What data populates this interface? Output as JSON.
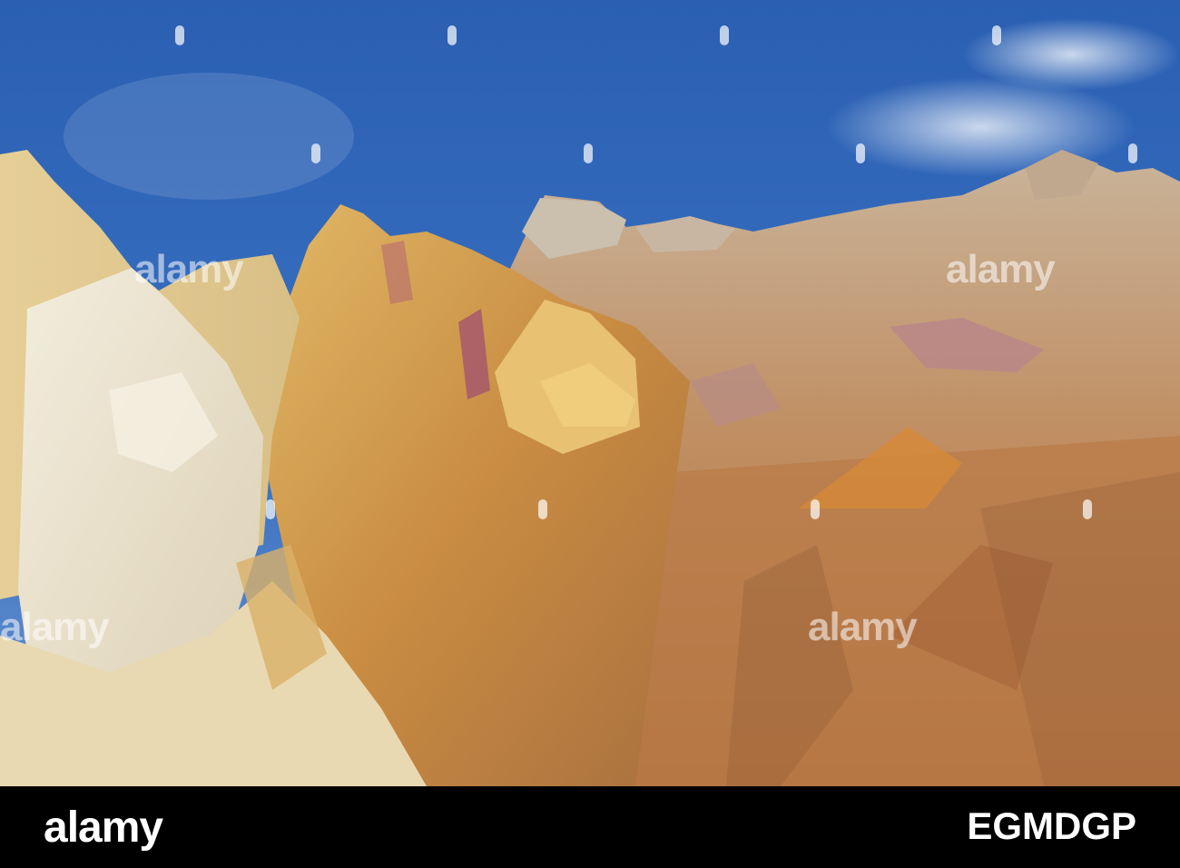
{
  "photo": {
    "subject_colors": {
      "sky": "#2f67b8",
      "white_sand": "#ece3cf",
      "ochre": "#d19a45",
      "rust": "#b06a3a",
      "pink": "#a8606a"
    }
  },
  "watermark": {
    "text": "alamy"
  },
  "footer": {
    "logo": "alamy",
    "image_id": "EGMDGP"
  }
}
